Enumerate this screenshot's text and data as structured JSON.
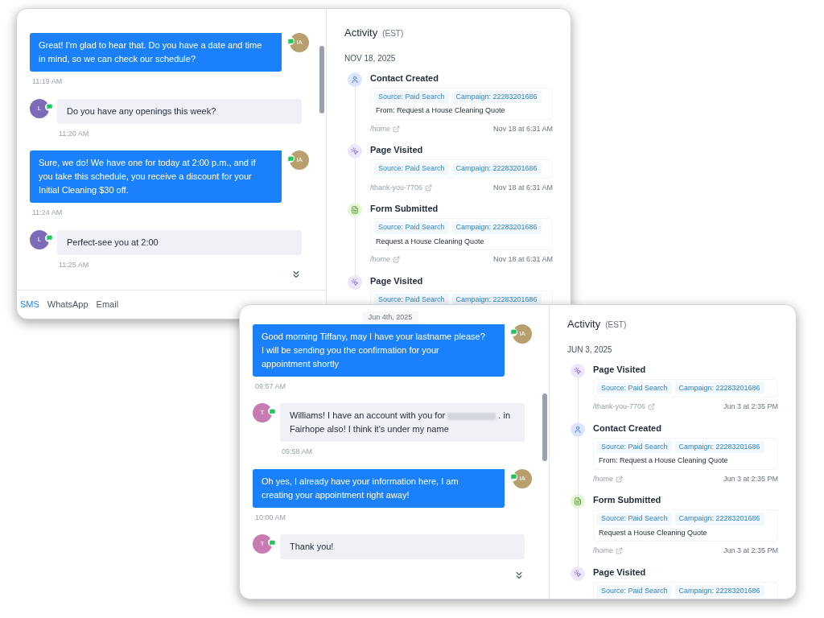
{
  "windows": [
    {
      "chat": {
        "messages": [
          {
            "kind": "outgoing",
            "avatar": "IA",
            "text": "Great! I'm glad to hear that. Do you have a date and time in mind, so we can check our schedule?",
            "time": "11:19 AM"
          },
          {
            "kind": "incoming",
            "avatar": "L",
            "text": "Do you have any openings this week?",
            "time": "11:20 AM"
          },
          {
            "kind": "outgoing",
            "avatar": "IA",
            "text": "Sure, we do! We have one for today at 2:00 p.m., and if you take this schedule, you receive a discount for your Initial Cleaning $30 off.",
            "time": "11:24 AM"
          },
          {
            "kind": "incoming",
            "avatar": "L",
            "text": "Perfect-see you at 2:00",
            "time": "11:25 AM"
          }
        ]
      },
      "channel_tabs": [
        {
          "label": "SMS",
          "selected": true
        },
        {
          "label": "WhatsApp",
          "selected": false
        },
        {
          "label": "Email",
          "selected": false
        }
      ],
      "activity": {
        "title": "Activity",
        "timezone": "(EST)",
        "date": "NOV 18, 2025",
        "events": [
          {
            "kind": "contact",
            "title": "Contact Created",
            "tags": [
              "Source: Paid Search",
              "Campaign: 22283201686"
            ],
            "detail": "From: Request a House Cleaning Quote",
            "path": "/home",
            "time": "Nov 18 at 6:31 AM"
          },
          {
            "kind": "page",
            "title": "Page Visited",
            "tags": [
              "Source: Paid Search",
              "Campaign: 22283201686"
            ],
            "path": "/thank-you-7706",
            "time": "Nov 18 at 6:31 AM"
          },
          {
            "kind": "form",
            "title": "Form Submitted",
            "tags": [
              "Source: Paid Search",
              "Campaign: 22283201686"
            ],
            "detail": "Request a House Cleaning Quote",
            "path": "/home",
            "time": "Nov 18 at 6:31 AM"
          },
          {
            "kind": "page",
            "title": "Page Visited",
            "tags": [
              "Source: Paid Search",
              "Campaign: 22283201686"
            ]
          }
        ]
      }
    },
    {
      "chat": {
        "date_chip": "Jun 4th, 2025",
        "messages": [
          {
            "kind": "outgoing",
            "avatar": "IA",
            "text": "Good morning Tiffany, may I have your lastname please? I will be sending you the confirmation for your appointment shortly",
            "time": "09:57 AM"
          },
          {
            "kind": "incoming",
            "avatar": "T",
            "parts": [
              "Williams! I have an account with you for",
              ". in Fairhope also! I think it's under my name"
            ],
            "time": "09:58 AM"
          },
          {
            "kind": "outgoing",
            "avatar": "IA",
            "text": "Oh yes, I already have your information here, I am creating your appointment right away!",
            "time": "10:00 AM"
          },
          {
            "kind": "incoming",
            "avatar": "T",
            "text": "Thank you!"
          }
        ]
      },
      "activity": {
        "title": "Activity",
        "timezone": "(EST)",
        "date": "JUN 3, 2025",
        "events": [
          {
            "kind": "page",
            "title": "Page Visited",
            "tags": [
              "Source: Paid Search",
              "Campaign: 22283201686"
            ],
            "path": "/thank-you-7706",
            "time": "Jun 3 at 2:35 PM"
          },
          {
            "kind": "contact",
            "title": "Contact Created",
            "tags": [
              "Source: Paid Search",
              "Campaign: 22283201686"
            ],
            "detail": "From: Request a House Cleaning Quote",
            "path": "/home",
            "time": "Jun 3 at 2:35 PM"
          },
          {
            "kind": "form",
            "title": "Form Submitted",
            "tags": [
              "Source: Paid Search",
              "Campaign: 22283201686"
            ],
            "detail": "Request a House Cleaning Quote",
            "path": "/home",
            "time": "Jun 3 at 2:35 PM"
          },
          {
            "kind": "page",
            "title": "Page Visited",
            "tags": [
              "Source: Paid Search",
              "Campaign: 22283201686"
            ]
          }
        ]
      }
    }
  ]
}
